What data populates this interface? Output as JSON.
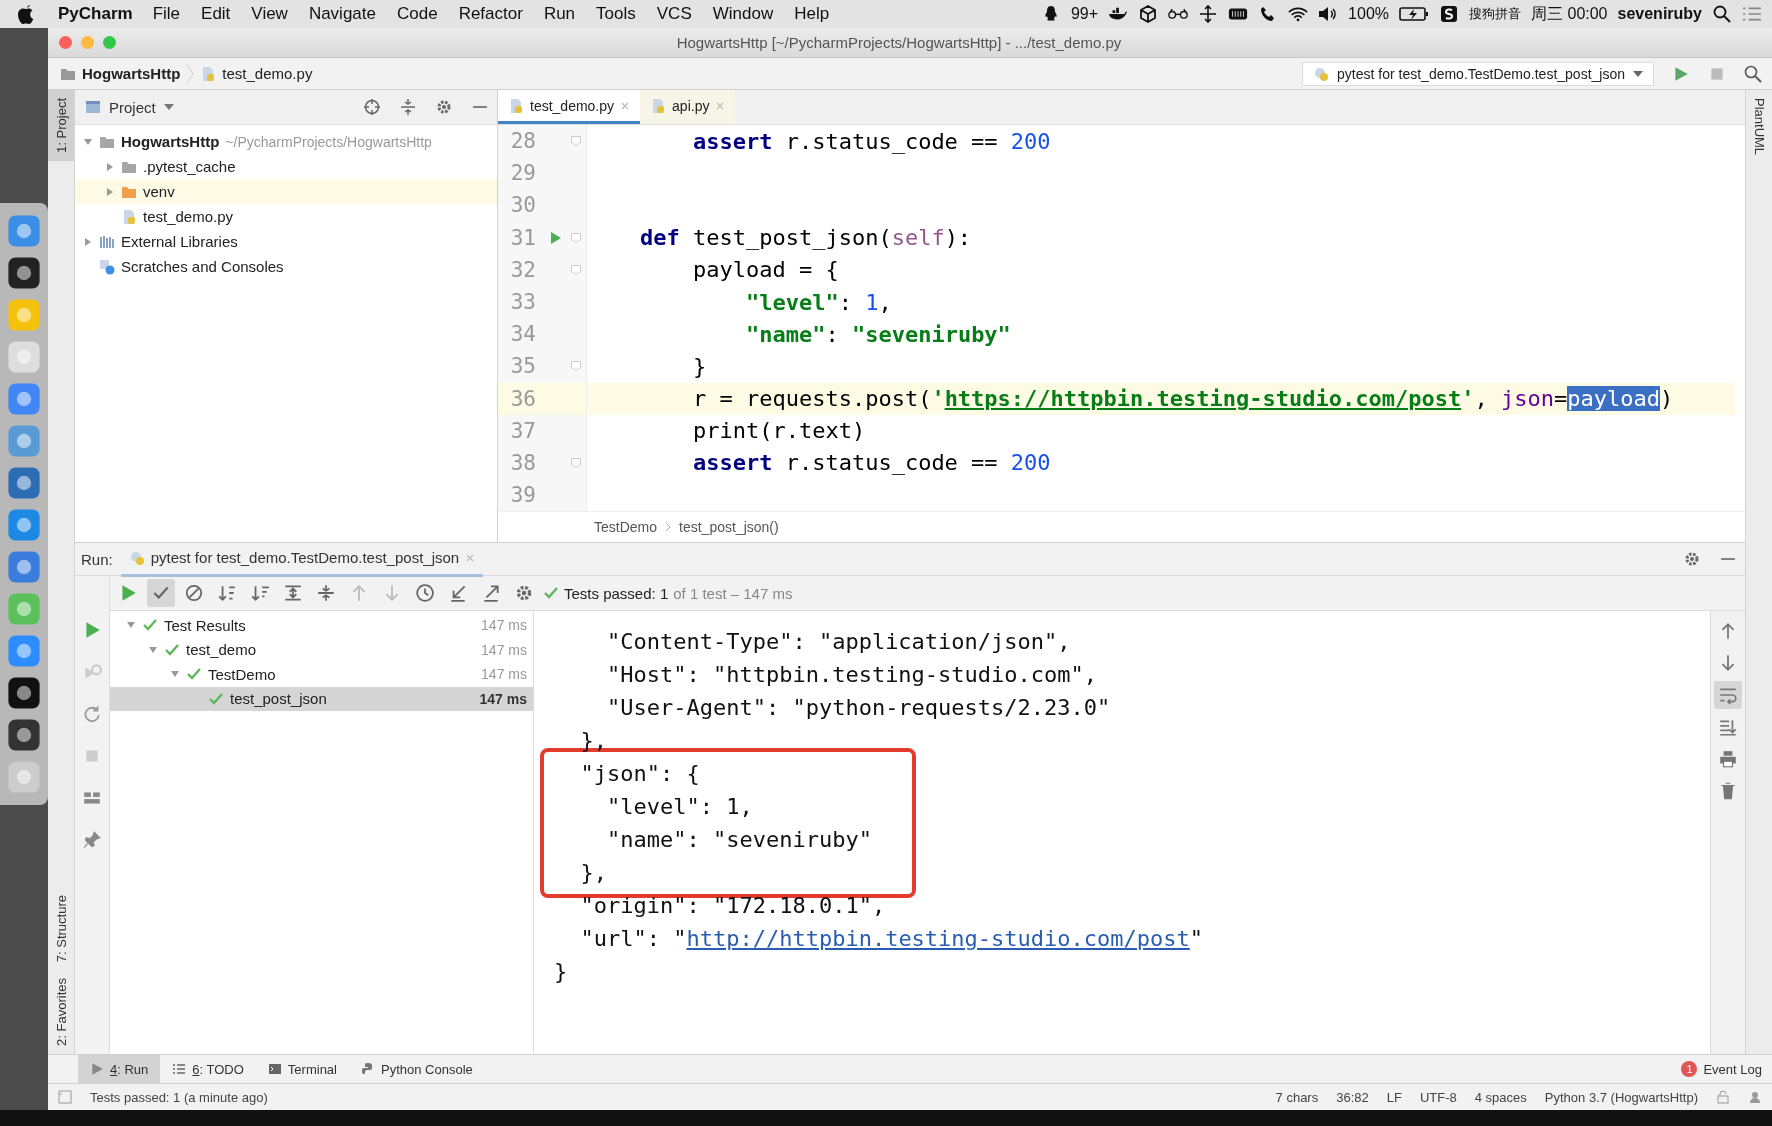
{
  "menubar": {
    "app": "PyCharm",
    "menus": [
      "File",
      "Edit",
      "View",
      "Navigate",
      "Code",
      "Refactor",
      "Run",
      "Tools",
      "VCS",
      "Window",
      "Help"
    ],
    "status": {
      "notification_count": "99+",
      "battery": "100%",
      "input_method": "搜狗拼音",
      "clock": "周三 00:00",
      "user": "seveniruby"
    }
  },
  "window": {
    "title": "HogwartsHttp [~/PycharmProjects/HogwartsHttp] - .../test_demo.py"
  },
  "navbar": {
    "breadcrumbs": [
      "HogwartsHttp",
      "test_demo.py"
    ],
    "run_config": "pytest for test_demo.TestDemo.test_post_json"
  },
  "tool_strip": {
    "left_top": "1: Project",
    "left_bottom": [
      "7: Structure",
      "2: Favorites"
    ],
    "right": "PlantUML"
  },
  "project": {
    "title": "Project",
    "tree": [
      {
        "label": "HogwartsHttp",
        "kind": "module",
        "path_hint": "~/PycharmProjects/HogwartsHttp",
        "expanded": true,
        "highlighted": false,
        "children": [
          {
            "label": ".pytest_cache",
            "kind": "folder",
            "expanded": false,
            "highlighted": false
          },
          {
            "label": "venv",
            "kind": "excluded_folder",
            "expanded": false,
            "highlighted": true
          },
          {
            "label": "test_demo.py",
            "kind": "python_file",
            "highlighted": false
          }
        ]
      },
      {
        "label": "External Libraries",
        "kind": "libraries",
        "expanded": false,
        "highlighted": false
      },
      {
        "label": "Scratches and Consoles",
        "kind": "scratches",
        "highlighted": false
      }
    ]
  },
  "editor": {
    "tabs": [
      {
        "label": "test_demo.py",
        "selected": true
      },
      {
        "label": "api.py",
        "selected": false
      }
    ],
    "lines": [
      {
        "number": "28",
        "fold": true,
        "run": false,
        "current": false,
        "tokens": [
          {
            "kind": "kw",
            "text": "        assert"
          },
          {
            "kind": "plain",
            "text": " r.status_code == "
          },
          {
            "kind": "num",
            "text": "200"
          }
        ]
      },
      {
        "number": "29",
        "fold": false,
        "run": false,
        "current": false
      },
      {
        "number": "30",
        "fold": false,
        "run": false,
        "current": false
      },
      {
        "number": "31",
        "fold": true,
        "run": true,
        "current": false,
        "tokens": [
          {
            "kind": "kw",
            "text": "    def"
          },
          {
            "kind": "plain",
            "text": " test_post_json("
          },
          {
            "kind": "self",
            "text": "self"
          },
          {
            "kind": "plain",
            "text": "):"
          }
        ]
      },
      {
        "number": "32",
        "fold": true,
        "run": false,
        "current": false,
        "tokens": [
          {
            "kind": "plain",
            "text": "        payload = {"
          }
        ]
      },
      {
        "number": "33",
        "fold": false,
        "run": false,
        "current": false,
        "tokens": [
          {
            "kind": "str",
            "text": "            \"level\""
          },
          {
            "kind": "plain",
            "text": ": "
          },
          {
            "kind": "num",
            "text": "1"
          },
          {
            "kind": "plain",
            "text": ","
          }
        ]
      },
      {
        "number": "34",
        "fold": false,
        "run": false,
        "current": false,
        "tokens": [
          {
            "kind": "str",
            "text": "            \"name\""
          },
          {
            "kind": "plain",
            "text": ": "
          },
          {
            "kind": "str",
            "text": "\"seveniruby\""
          }
        ]
      },
      {
        "number": "35",
        "fold": true,
        "run": false,
        "current": false,
        "tokens": [
          {
            "kind": "plain",
            "text": "        }"
          }
        ]
      },
      {
        "number": "36",
        "fold": false,
        "run": false,
        "current": true,
        "tokens": [
          {
            "kind": "plain",
            "text": "        r = requests.post("
          },
          {
            "kind": "str",
            "text": "'"
          },
          {
            "kind": "url",
            "text": "https://httpbin.testing-studio.com/post"
          },
          {
            "kind": "str",
            "text": "'"
          },
          {
            "kind": "plain",
            "text": ", "
          },
          {
            "kind": "arg",
            "text": "json"
          },
          {
            "kind": "plain",
            "text": "="
          },
          {
            "kind": "sel",
            "text": "payload"
          },
          {
            "kind": "plain",
            "text": ")"
          }
        ]
      },
      {
        "number": "37",
        "fold": false,
        "run": false,
        "current": false,
        "tokens": [
          {
            "kind": "plain",
            "text": "        print(r.text)"
          }
        ]
      },
      {
        "number": "38",
        "fold": true,
        "run": false,
        "current": false,
        "tokens": [
          {
            "kind": "kw",
            "text": "        assert"
          },
          {
            "kind": "plain",
            "text": " r.status_code == "
          },
          {
            "kind": "num",
            "text": "200"
          }
        ]
      },
      {
        "number": "39",
        "fold": false,
        "run": false,
        "current": false
      }
    ],
    "breadcrumbs": [
      "TestDemo",
      "test_post_json()"
    ]
  },
  "run": {
    "label": "Run:",
    "tab": "pytest for test_demo.TestDemo.test_post_json",
    "status": "Tests passed: 1",
    "status_detail": "of 1 test – 147 ms",
    "results": [
      {
        "label": "Test Results",
        "time": "147 ms",
        "passed": true,
        "expanded": true,
        "selected": false,
        "children": [
          {
            "label": "test_demo",
            "time": "147 ms",
            "passed": true,
            "expanded": true,
            "selected": false,
            "children": [
              {
                "label": "TestDemo",
                "time": "147 ms",
                "passed": true,
                "expanded": true,
                "selected": false,
                "children": [
                  {
                    "label": "test_post_json",
                    "time": "147 ms",
                    "passed": true,
                    "selected": true
                  }
                ]
              }
            ]
          }
        ]
      }
    ],
    "output": [
      {
        "highlighted": false,
        "lines": [
          [
            {
              "kind": "plain",
              "text": "    \"Content-Type\": \"application/json\","
            }
          ],
          [
            {
              "kind": "plain",
              "text": "    \"Host\": \"httpbin.testing-studio.com\","
            }
          ],
          [
            {
              "kind": "plain",
              "text": "    \"User-Agent\": \"python-requests/2.23.0\""
            }
          ],
          [
            {
              "kind": "plain",
              "text": "  },"
            }
          ]
        ]
      },
      {
        "highlighted": true,
        "lines": [
          [
            {
              "kind": "plain",
              "text": "  \"json\": {"
            }
          ],
          [
            {
              "kind": "plain",
              "text": "    \"level\": 1,"
            }
          ],
          [
            {
              "kind": "plain",
              "text": "    \"name\": \"seveniruby\""
            }
          ],
          [
            {
              "kind": "plain",
              "text": "  },"
            }
          ]
        ]
      },
      {
        "highlighted": false,
        "lines": [
          [
            {
              "kind": "plain",
              "text": "  \"origin\": \"172.18.0.1\","
            }
          ],
          [
            {
              "kind": "plain",
              "text": "  \"url\": \""
            },
            {
              "kind": "link",
              "text": "http://httpbin.testing-studio.com/post"
            },
            {
              "kind": "plain",
              "text": "\""
            }
          ],
          [
            {
              "kind": "plain",
              "text": "}"
            }
          ]
        ]
      }
    ]
  },
  "bottom_tabs": [
    {
      "key": "4",
      "label": ": Run",
      "selected": true
    },
    {
      "key": "6",
      "label": ": TODO",
      "selected": false
    },
    {
      "label": "Terminal",
      "selected": false
    },
    {
      "label": "Python Console",
      "selected": false
    }
  ],
  "event_log": {
    "badge": "1",
    "label": "Event Log"
  },
  "status_bar": {
    "message": "Tests passed: 1 (a minute ago)",
    "items": [
      "7 chars",
      "36:82",
      "LF",
      "UTF-8",
      "4 spaces",
      "Python 3.7 (HogwartsHttp)"
    ]
  }
}
